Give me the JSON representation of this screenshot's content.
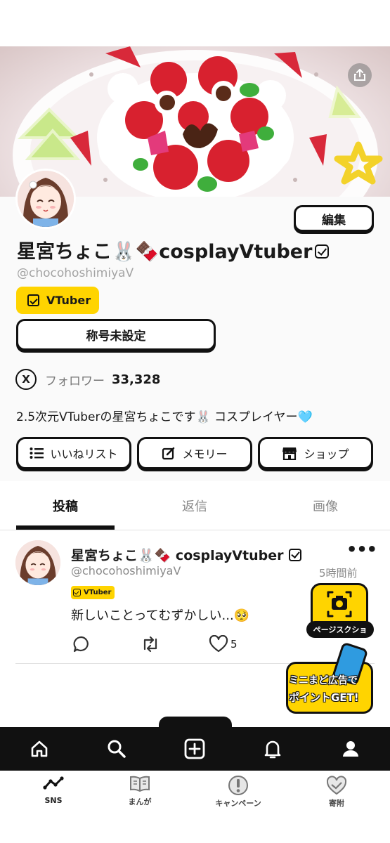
{
  "profile": {
    "name_prefix": "星宮ちょこ🐰🍫cosplayVtuber",
    "handle": "@chocohoshimiyaV",
    "badge": "VTuber",
    "edit_label": "編集",
    "title_button": "称号未設定",
    "follower_label": "フォロワー",
    "follower_count": "33,328",
    "x_label": "X",
    "bio": "2.5次元VTuberの星宮ちょこです🐰 コスプレイヤー🩵",
    "actions": [
      {
        "label": "いいねリスト",
        "icon": "list-icon"
      },
      {
        "label": "メモリー",
        "icon": "edit-icon"
      },
      {
        "label": "ショップ",
        "icon": "shop-icon"
      }
    ]
  },
  "tabs": [
    {
      "label": "投稿",
      "active": true
    },
    {
      "label": "返信",
      "active": false
    },
    {
      "label": "画像",
      "active": false
    }
  ],
  "post": {
    "author": "星宮ちょこ🐰🍫 cosplayVtuber",
    "handle": "@chocohoshimiyaV",
    "time": "5時間前",
    "badge": "VTuber",
    "text": "新しいことってむずかしい...🥺",
    "likes": "5",
    "more": "•••"
  },
  "floating": {
    "screenshot_label": "ページスクショ",
    "ad_line1": "ミニまど広告で",
    "ad_line2": "ポイントGET!"
  },
  "bottom_bar": [
    "home-icon",
    "search-icon",
    "plus-icon",
    "bell-icon",
    "profile-icon"
  ],
  "app_nav": [
    {
      "label": "SNS",
      "icon": "sns-icon"
    },
    {
      "label": "まんが",
      "icon": "book-icon"
    },
    {
      "label": "キャンペーン",
      "icon": "exclamation-icon"
    },
    {
      "label": "寄附",
      "icon": "heart-hands-icon"
    }
  ],
  "colors": {
    "accent": "#ffd400",
    "text": "#111111",
    "muted": "#8a8a8a",
    "bar": "#111111"
  }
}
